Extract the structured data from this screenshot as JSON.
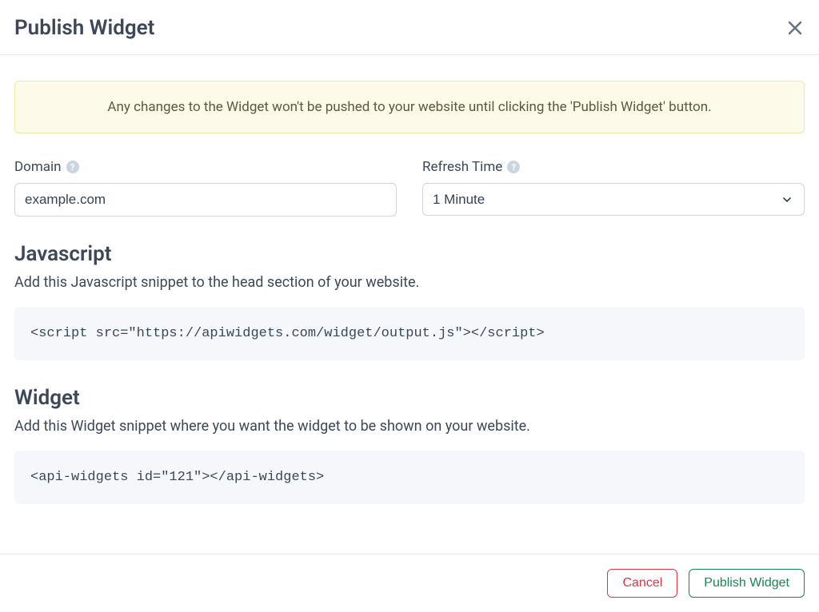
{
  "header": {
    "title": "Publish Widget"
  },
  "alert": {
    "message": "Any changes to the Widget won't be pushed to your website until clicking the 'Publish Widget' button."
  },
  "form": {
    "domain": {
      "label": "Domain",
      "value": "example.com"
    },
    "refresh_time": {
      "label": "Refresh Time",
      "selected": "1 Minute"
    }
  },
  "sections": {
    "javascript": {
      "heading": "Javascript",
      "description": "Add this Javascript snippet to the head section of your website.",
      "code": "<script src=\"https://apiwidgets.com/widget/output.js\"></script>"
    },
    "widget": {
      "heading": "Widget",
      "description": "Add this Widget snippet where you want the widget to be shown on your website.",
      "code": "<api-widgets id=\"121\"></api-widgets>"
    }
  },
  "footer": {
    "cancel_label": "Cancel",
    "publish_label": "Publish Widget"
  }
}
